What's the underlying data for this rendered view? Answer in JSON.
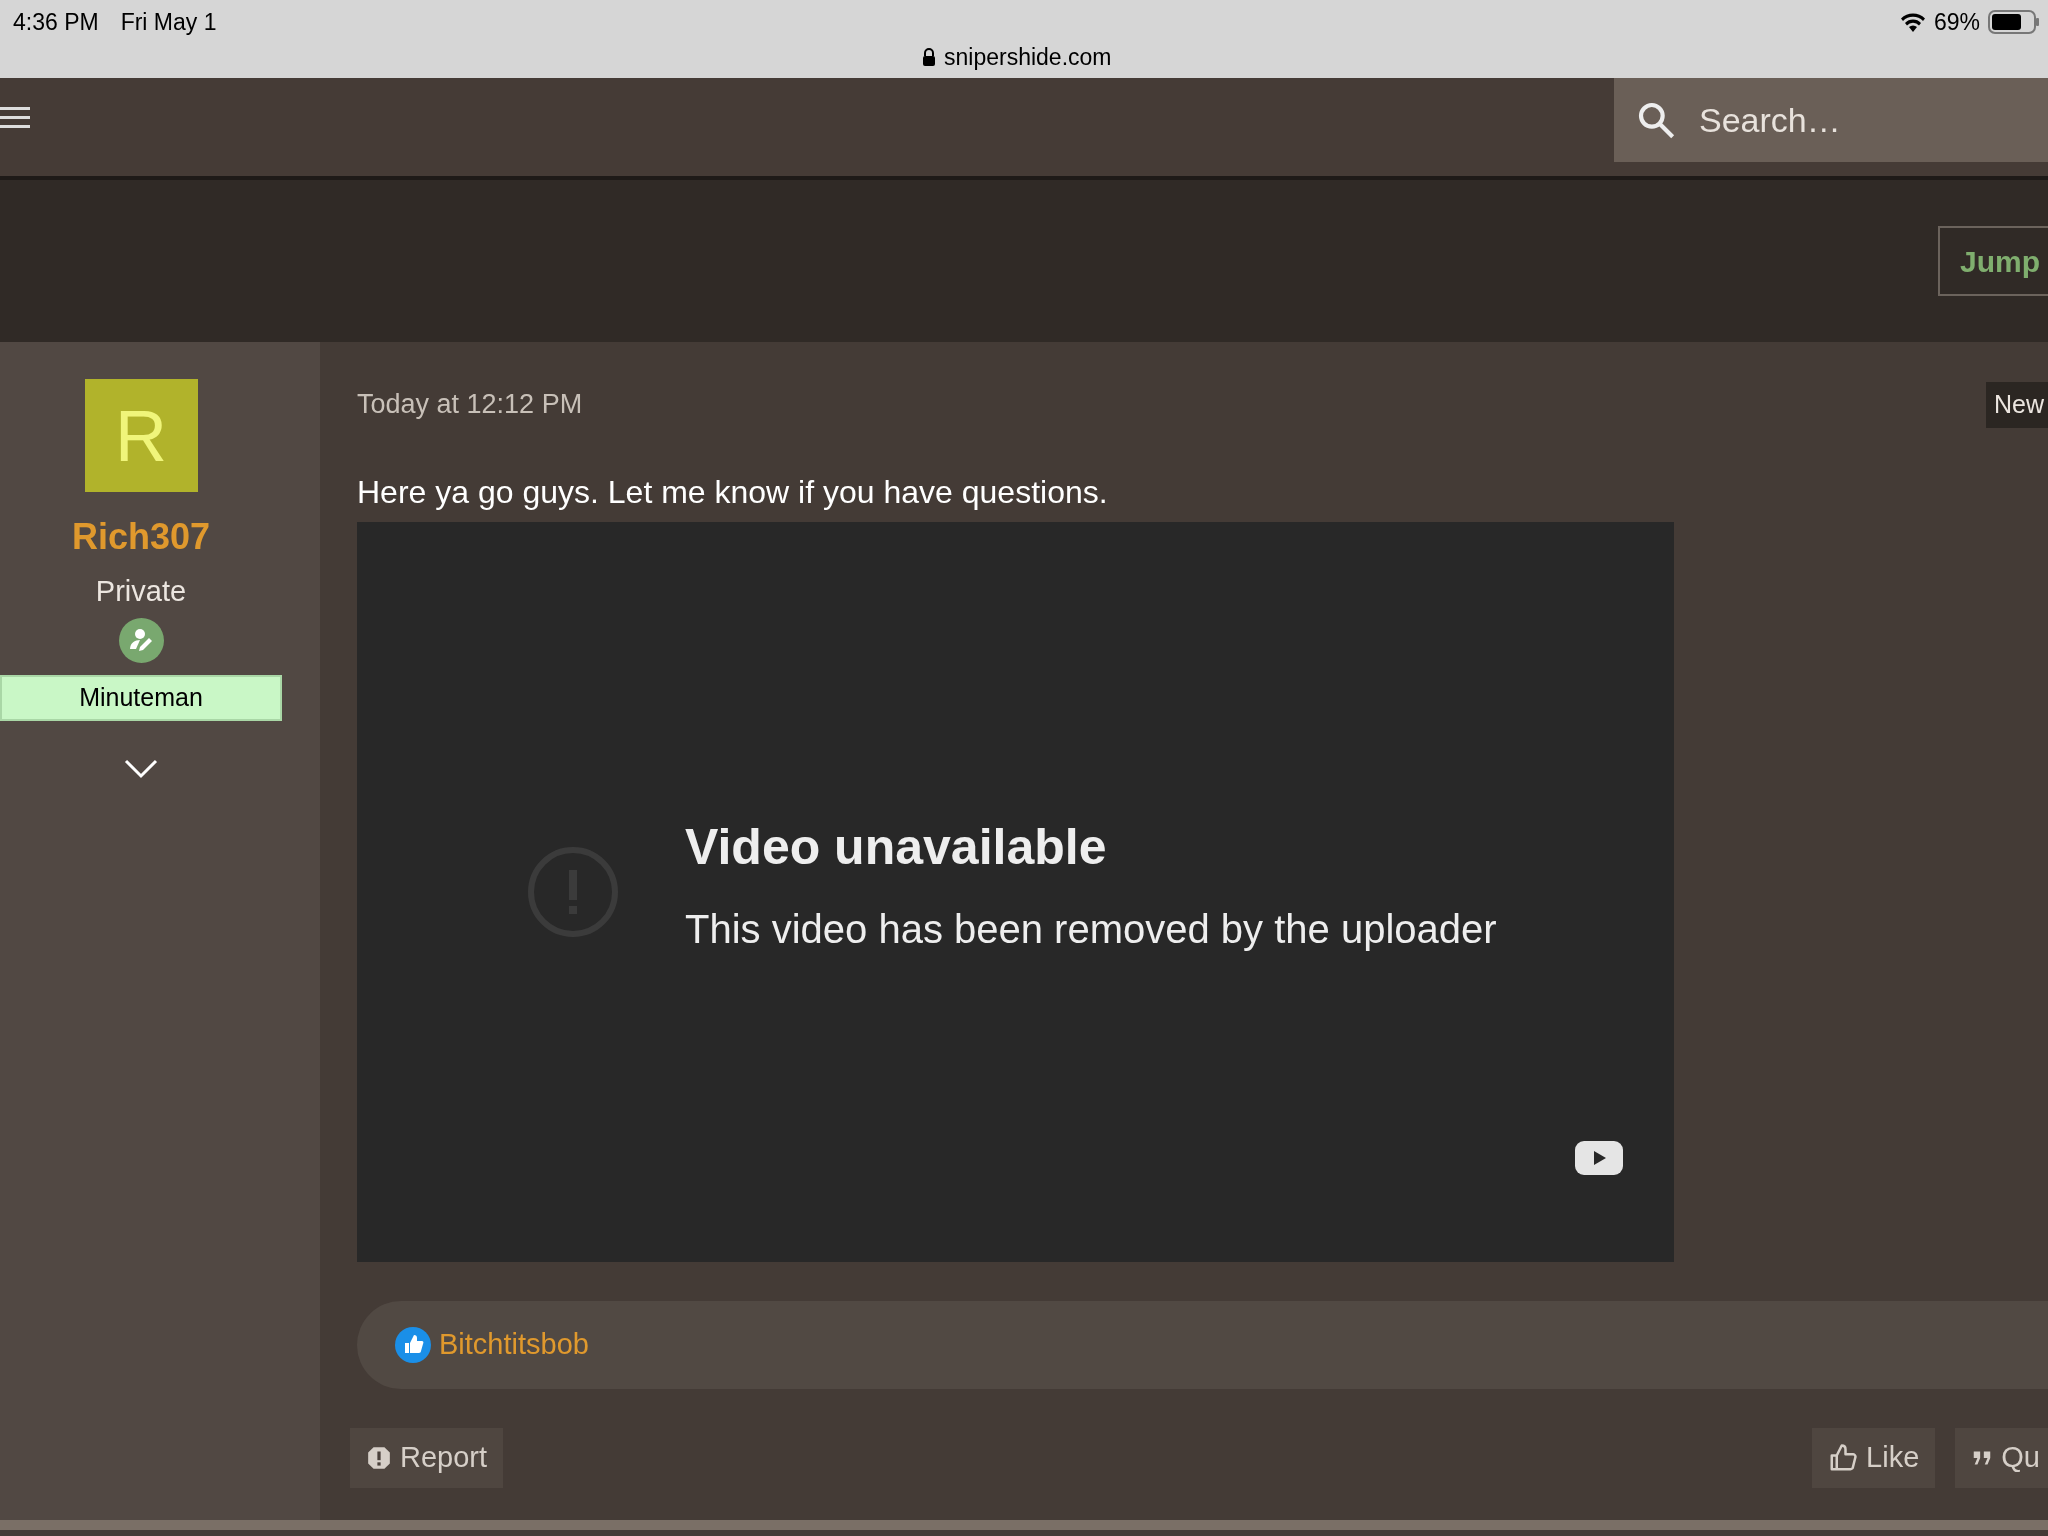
{
  "status_bar": {
    "time": "4:36 PM",
    "date": "Fri May 1",
    "url": "snipershide.com",
    "battery": "69%"
  },
  "header": {
    "search": {
      "placeholder": "Search…"
    }
  },
  "jump_button": "Jump",
  "post": {
    "author": {
      "initial": "R",
      "name": "Rich307",
      "rank": "Private",
      "banner": "Minuteman"
    },
    "timestamp": "Today at 12:12 PM",
    "badge": "New",
    "text": "Here ya go guys. Let me know if you have questions.",
    "video": {
      "title": "Video unavailable",
      "message": "This video has been removed by the uploader"
    },
    "reactions": {
      "user": "Bitchtitsbob"
    },
    "actions": [
      {
        "kind": "report",
        "label": "Report"
      },
      {
        "kind": "like",
        "label": "Like"
      },
      {
        "kind": "quote",
        "label": "Qu"
      }
    ]
  }
}
